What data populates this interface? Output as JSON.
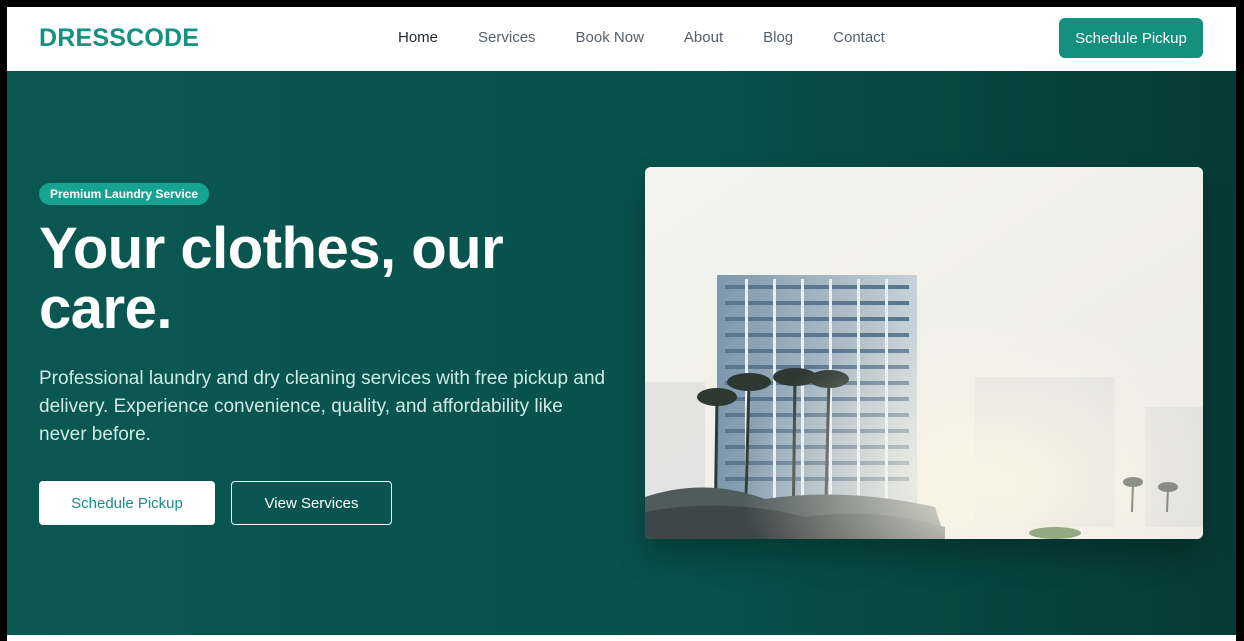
{
  "brand": {
    "name": "DRESSCODE",
    "color": "#16907f"
  },
  "nav": {
    "links": [
      {
        "label": "Home",
        "active": true
      },
      {
        "label": "Services",
        "active": false
      },
      {
        "label": "Book Now",
        "active": false
      },
      {
        "label": "About",
        "active": false
      },
      {
        "label": "Blog",
        "active": false
      },
      {
        "label": "Contact",
        "active": false
      }
    ],
    "cta_label": "Schedule Pickup"
  },
  "hero": {
    "badge": "Premium Laundry Service",
    "headline": "Your clothes, our care.",
    "subtext": "Professional laundry and dry cleaning services with free pickup and delivery. Experience convenience, quality, and affordability like never before.",
    "primary_button": "Schedule Pickup",
    "secondary_button": "View Services",
    "image_icon": "building-photo"
  },
  "colors": {
    "accent": "#16907f",
    "hero_bg": "#08514b",
    "badge_bg": "#17a391"
  }
}
